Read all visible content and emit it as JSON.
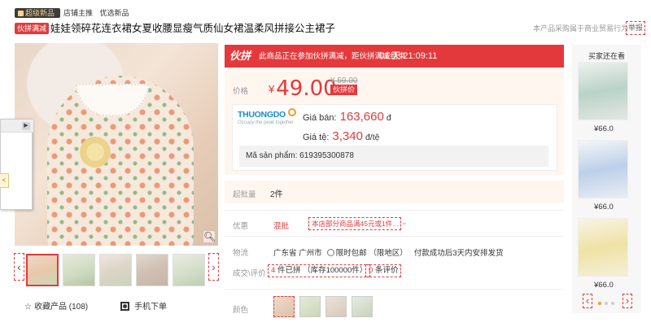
{
  "topbar": {
    "vip_badge": "超级新品",
    "links": [
      "店铺主推",
      "优选新品"
    ]
  },
  "product": {
    "badge": "伙拼满减",
    "title": "娃娃领碎花连衣裙女夏收腰显瘦气质仙女裙温柔风拼接公主裙子",
    "commercial_note": "本产品采购属于商业贸易行为",
    "report_label": "举报"
  },
  "promo_bar": {
    "logo": "伙拼",
    "text": "此商品正在参加伙拼满减，距伙拼满减结束",
    "countdown": "01 天 21:09:11"
  },
  "price": {
    "label": "价格",
    "currency": "¥",
    "current": "49.00",
    "original": "¥ 59.00",
    "tag": "伙拼价"
  },
  "thuongdo": {
    "logo_text": "THUONGDO",
    "logo_tagline": "Occupy the peak together",
    "sale_label": "Giá bán:",
    "sale_value": "163,660",
    "sale_unit": "đ",
    "rate_label": "Giá tệ:",
    "rate_value": "3,340",
    "rate_unit": "đ/tệ",
    "code_label": "Mã sản phẩm:",
    "code_value": "619395300878"
  },
  "min_order": {
    "label": "起批量",
    "value": "2件"
  },
  "offers": {
    "label": "优惠",
    "type": "混批",
    "detail": "本店部分商品满45元或1件…"
  },
  "shipping": {
    "label": "物流",
    "origin": "广东省 广州市",
    "free": "限时包邮 （限地区）",
    "note": "付款成功后3天内安排发货"
  },
  "sales": {
    "label": "成交\\评价",
    "sold_count": "4",
    "sold_text": "件已拼 （库存100000件）",
    "review_count": "0",
    "review_text": "条评价"
  },
  "colors": {
    "label": "颜色"
  },
  "left": {
    "favorite_label": "收藏产品",
    "favorite_count": "(108)",
    "mobile_label": "手机下单"
  },
  "side": {
    "title": "买家还在看",
    "items": [
      {
        "price": "¥66.0"
      },
      {
        "price": "¥66.0"
      },
      {
        "price": "¥66.0"
      }
    ]
  },
  "colors_palette": {
    "accent": "#e4393c",
    "price_bg": "#fff6f0",
    "brand_blue": "#1e8ecb"
  }
}
